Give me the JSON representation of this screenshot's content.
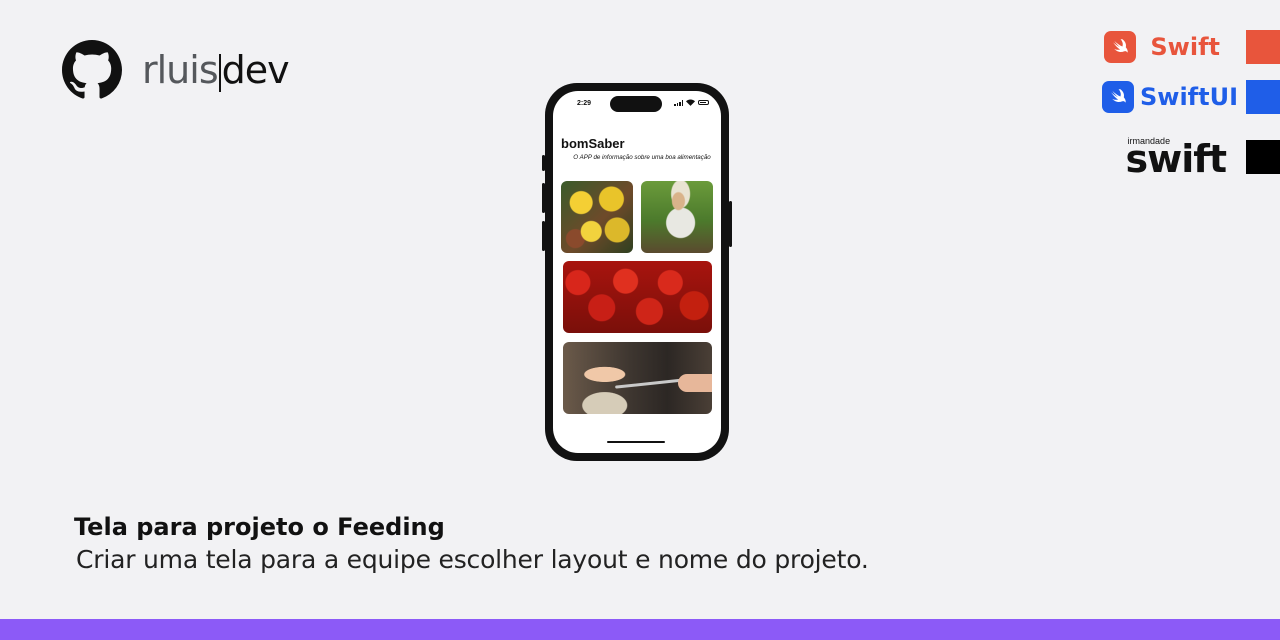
{
  "brand": {
    "name_light": "rluis",
    "name_bold": "dev",
    "logo_icon": "github-icon"
  },
  "tech": [
    {
      "label": "Swift",
      "color": "#e8553c",
      "icon": "swift-icon"
    },
    {
      "label": "SwiftUI",
      "color": "#1f5ee8",
      "icon": "swift-icon"
    },
    {
      "label_small": "irmandade",
      "label": "swift",
      "color": "#000000"
    }
  ],
  "phone": {
    "time": "2:29",
    "app_title": "bomSaber",
    "app_subtitle": "O APP de informação sobre uma boa alimentação",
    "images": [
      "lemons-photo",
      "farmer-photo",
      "tomatoes-photo",
      "baby-eating-photo"
    ]
  },
  "content": {
    "headline": "Tela para projeto o Feeding",
    "description": "Criar uma tela para a equipe escolher layout e nome do projeto."
  },
  "colors": {
    "background": "#f2f2f4",
    "bottom_bar": "#8c5af7"
  }
}
